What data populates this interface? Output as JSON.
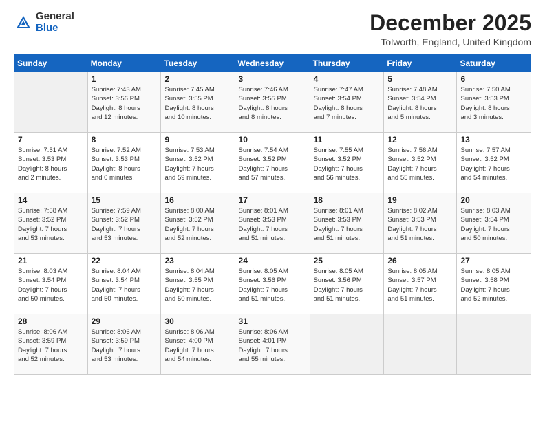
{
  "logo": {
    "general": "General",
    "blue": "Blue"
  },
  "title": "December 2025",
  "location": "Tolworth, England, United Kingdom",
  "days_of_week": [
    "Sunday",
    "Monday",
    "Tuesday",
    "Wednesday",
    "Thursday",
    "Friday",
    "Saturday"
  ],
  "weeks": [
    [
      {
        "day": "",
        "info": ""
      },
      {
        "day": "1",
        "info": "Sunrise: 7:43 AM\nSunset: 3:56 PM\nDaylight: 8 hours\nand 12 minutes."
      },
      {
        "day": "2",
        "info": "Sunrise: 7:45 AM\nSunset: 3:55 PM\nDaylight: 8 hours\nand 10 minutes."
      },
      {
        "day": "3",
        "info": "Sunrise: 7:46 AM\nSunset: 3:55 PM\nDaylight: 8 hours\nand 8 minutes."
      },
      {
        "day": "4",
        "info": "Sunrise: 7:47 AM\nSunset: 3:54 PM\nDaylight: 8 hours\nand 7 minutes."
      },
      {
        "day": "5",
        "info": "Sunrise: 7:48 AM\nSunset: 3:54 PM\nDaylight: 8 hours\nand 5 minutes."
      },
      {
        "day": "6",
        "info": "Sunrise: 7:50 AM\nSunset: 3:53 PM\nDaylight: 8 hours\nand 3 minutes."
      }
    ],
    [
      {
        "day": "7",
        "info": "Sunrise: 7:51 AM\nSunset: 3:53 PM\nDaylight: 8 hours\nand 2 minutes."
      },
      {
        "day": "8",
        "info": "Sunrise: 7:52 AM\nSunset: 3:53 PM\nDaylight: 8 hours\nand 0 minutes."
      },
      {
        "day": "9",
        "info": "Sunrise: 7:53 AM\nSunset: 3:52 PM\nDaylight: 7 hours\nand 59 minutes."
      },
      {
        "day": "10",
        "info": "Sunrise: 7:54 AM\nSunset: 3:52 PM\nDaylight: 7 hours\nand 57 minutes."
      },
      {
        "day": "11",
        "info": "Sunrise: 7:55 AM\nSunset: 3:52 PM\nDaylight: 7 hours\nand 56 minutes."
      },
      {
        "day": "12",
        "info": "Sunrise: 7:56 AM\nSunset: 3:52 PM\nDaylight: 7 hours\nand 55 minutes."
      },
      {
        "day": "13",
        "info": "Sunrise: 7:57 AM\nSunset: 3:52 PM\nDaylight: 7 hours\nand 54 minutes."
      }
    ],
    [
      {
        "day": "14",
        "info": "Sunrise: 7:58 AM\nSunset: 3:52 PM\nDaylight: 7 hours\nand 53 minutes."
      },
      {
        "day": "15",
        "info": "Sunrise: 7:59 AM\nSunset: 3:52 PM\nDaylight: 7 hours\nand 53 minutes."
      },
      {
        "day": "16",
        "info": "Sunrise: 8:00 AM\nSunset: 3:52 PM\nDaylight: 7 hours\nand 52 minutes."
      },
      {
        "day": "17",
        "info": "Sunrise: 8:01 AM\nSunset: 3:53 PM\nDaylight: 7 hours\nand 51 minutes."
      },
      {
        "day": "18",
        "info": "Sunrise: 8:01 AM\nSunset: 3:53 PM\nDaylight: 7 hours\nand 51 minutes."
      },
      {
        "day": "19",
        "info": "Sunrise: 8:02 AM\nSunset: 3:53 PM\nDaylight: 7 hours\nand 51 minutes."
      },
      {
        "day": "20",
        "info": "Sunrise: 8:03 AM\nSunset: 3:54 PM\nDaylight: 7 hours\nand 50 minutes."
      }
    ],
    [
      {
        "day": "21",
        "info": "Sunrise: 8:03 AM\nSunset: 3:54 PM\nDaylight: 7 hours\nand 50 minutes."
      },
      {
        "day": "22",
        "info": "Sunrise: 8:04 AM\nSunset: 3:54 PM\nDaylight: 7 hours\nand 50 minutes."
      },
      {
        "day": "23",
        "info": "Sunrise: 8:04 AM\nSunset: 3:55 PM\nDaylight: 7 hours\nand 50 minutes."
      },
      {
        "day": "24",
        "info": "Sunrise: 8:05 AM\nSunset: 3:56 PM\nDaylight: 7 hours\nand 51 minutes."
      },
      {
        "day": "25",
        "info": "Sunrise: 8:05 AM\nSunset: 3:56 PM\nDaylight: 7 hours\nand 51 minutes."
      },
      {
        "day": "26",
        "info": "Sunrise: 8:05 AM\nSunset: 3:57 PM\nDaylight: 7 hours\nand 51 minutes."
      },
      {
        "day": "27",
        "info": "Sunrise: 8:05 AM\nSunset: 3:58 PM\nDaylight: 7 hours\nand 52 minutes."
      }
    ],
    [
      {
        "day": "28",
        "info": "Sunrise: 8:06 AM\nSunset: 3:59 PM\nDaylight: 7 hours\nand 52 minutes."
      },
      {
        "day": "29",
        "info": "Sunrise: 8:06 AM\nSunset: 3:59 PM\nDaylight: 7 hours\nand 53 minutes."
      },
      {
        "day": "30",
        "info": "Sunrise: 8:06 AM\nSunset: 4:00 PM\nDaylight: 7 hours\nand 54 minutes."
      },
      {
        "day": "31",
        "info": "Sunrise: 8:06 AM\nSunset: 4:01 PM\nDaylight: 7 hours\nand 55 minutes."
      },
      {
        "day": "",
        "info": ""
      },
      {
        "day": "",
        "info": ""
      },
      {
        "day": "",
        "info": ""
      }
    ]
  ]
}
